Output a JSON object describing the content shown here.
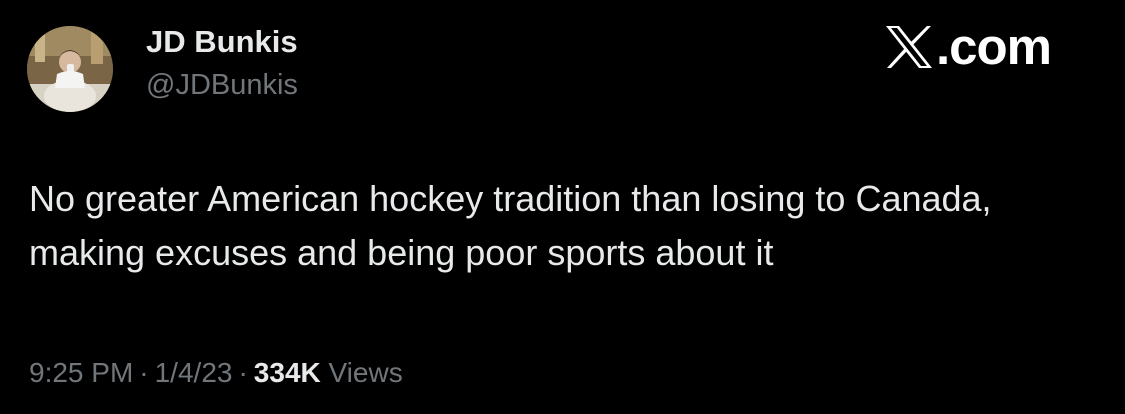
{
  "author": {
    "display_name": "JD Bunkis",
    "handle": "@JDBunkis",
    "avatar_icon": "profile-photo"
  },
  "brand": {
    "logo_icon": "x-logo-icon",
    "domain_text": ".com"
  },
  "tweet": {
    "text": "No greater American hockey tradition than losing to Canada, making excuses and being poor sports about it"
  },
  "meta": {
    "time": "9:25 PM",
    "separator": "·",
    "date": "1/4/23",
    "views_count": "334K",
    "views_label": "Views"
  },
  "colors": {
    "background": "#000000",
    "primary_text": "#e7e9ea",
    "secondary_text": "#71767b"
  }
}
